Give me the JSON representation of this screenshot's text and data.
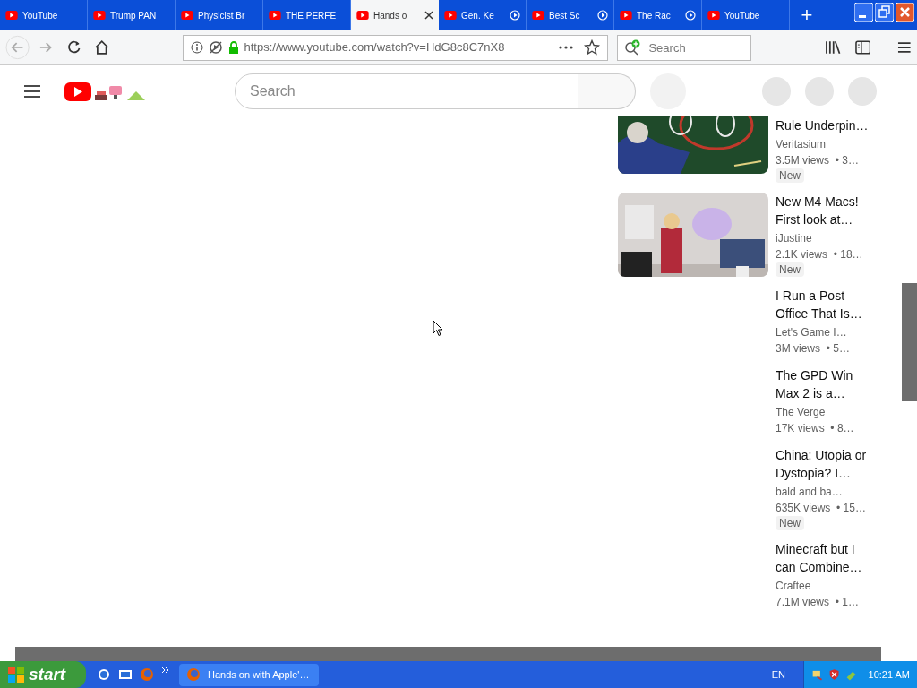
{
  "tabs": [
    {
      "label": "YouTube",
      "selected": false,
      "playing": false
    },
    {
      "label": "Trump PAN",
      "selected": false,
      "playing": false
    },
    {
      "label": "Physicist Br",
      "selected": false,
      "playing": false
    },
    {
      "label": "THE PERFE",
      "selected": false,
      "playing": false
    },
    {
      "label": "Hands o",
      "selected": true,
      "playing": false
    },
    {
      "label": "Gen. Ke",
      "selected": false,
      "playing": true
    },
    {
      "label": "Best Sc",
      "selected": false,
      "playing": true
    },
    {
      "label": "The Rac",
      "selected": false,
      "playing": true
    },
    {
      "label": "YouTube",
      "selected": false,
      "playing": false
    }
  ],
  "new_tab": "+",
  "address_bar": {
    "url": "https://www.youtube.com/watch?v=HdG8c8C7nX8"
  },
  "browser_search": {
    "placeholder": "Search"
  },
  "youtube_search": {
    "placeholder": "Search"
  },
  "videos": [
    {
      "title": "Rule Underpin…",
      "channel": "Veritasium",
      "meta": "3.5M views  • 3…",
      "badge": "New",
      "kind": "picture"
    },
    {
      "title": "New M4 Macs! First look at…",
      "channel": "iJustine",
      "meta": "2.1K views  • 18…",
      "badge": "New",
      "kind": "picture"
    },
    {
      "title": "I Run a Post Office That Is…",
      "channel": "Let's Game I…",
      "meta": "3M views  • 5…"
    },
    {
      "title": "The GPD Win Max 2 is a…",
      "channel": "The Verge",
      "meta": "17K views  • 8…"
    },
    {
      "title": "China: Utopia or Dystopia? I…",
      "channel": "bald and ba…",
      "meta": "635K views  • 15…",
      "badge": "New"
    },
    {
      "title": "Minecraft but I can Combine…",
      "channel": "Craftee",
      "meta": "7.1M views  • 1…"
    }
  ],
  "taskbar": {
    "start": "start",
    "task": "Hands on with Apple'…",
    "language": "EN",
    "clock": "10:21 AM"
  }
}
